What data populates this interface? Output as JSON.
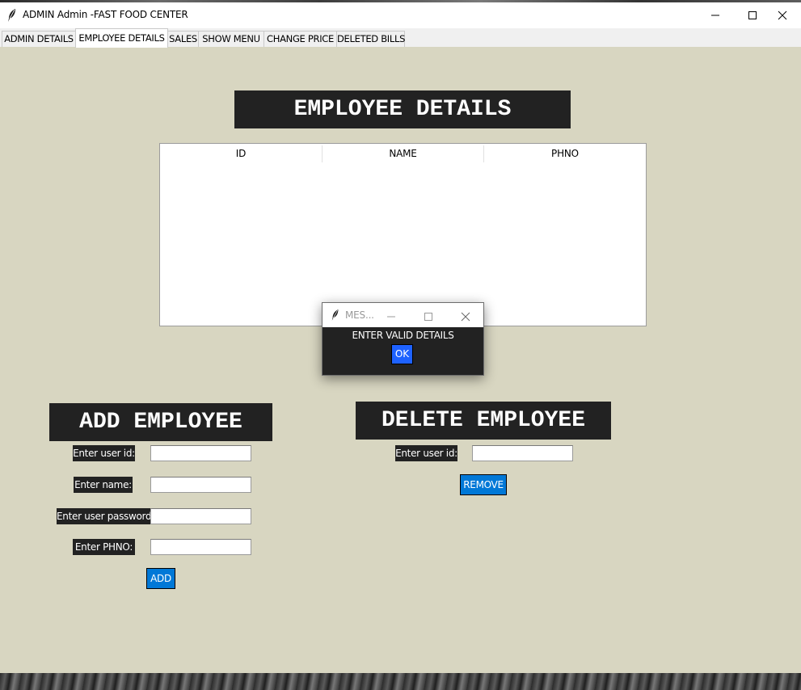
{
  "window": {
    "title": "ADMIN Admin -FAST FOOD CENTER",
    "background_color": "#d8d6c1"
  },
  "tabs": [
    {
      "label": "ADMIN DETAILS",
      "active": false
    },
    {
      "label": "EMPLOYEE DETAILS",
      "active": true
    },
    {
      "label": "SALES",
      "active": false
    },
    {
      "label": "SHOW MENU",
      "active": false
    },
    {
      "label": "CHANGE PRICE",
      "active": false
    },
    {
      "label": "DELETED BILLS",
      "active": false
    }
  ],
  "main": {
    "heading": "EMPLOYEE DETAILS",
    "table": {
      "columns": [
        "ID",
        "NAME",
        "PHNO"
      ],
      "rows": []
    }
  },
  "dialog": {
    "title": "MES...",
    "message": "ENTER VALID DETAILS",
    "ok_label": "OK"
  },
  "add_employee": {
    "heading": "ADD EMPLOYEE",
    "fields": [
      {
        "label": "Enter user id:",
        "value": ""
      },
      {
        "label": "Enter name:",
        "value": ""
      },
      {
        "label": "Enter user password:",
        "value": ""
      },
      {
        "label": "Enter PHNO:",
        "value": ""
      }
    ],
    "button_label": "ADD"
  },
  "delete_employee": {
    "heading": "DELETE EMPLOYEE",
    "field": {
      "label": "Enter user id:",
      "value": ""
    },
    "button_label": "REMOVE"
  },
  "colors": {
    "banner": "#222222",
    "button": "#0078d7",
    "dialog_ok": "#1e62ff"
  },
  "icons": {
    "app": "feather-icon",
    "minimize": "minimize-icon",
    "maximize": "maximize-icon",
    "close": "close-icon"
  }
}
